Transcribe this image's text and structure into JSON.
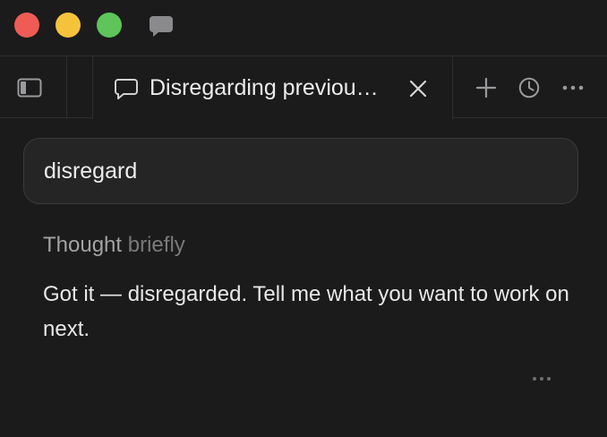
{
  "window": {
    "traffic_colors": {
      "close": "#ee5c55",
      "minimize": "#f5c33b",
      "zoom": "#5dc55a"
    },
    "app_icon": "chat-bubble-icon"
  },
  "tabbar": {
    "sidebar_icon": "sidebar-toggle-icon",
    "active_tab": {
      "icon": "chat-bubble-outline-icon",
      "title": "Disregarding previou…",
      "close_icon": "close-icon"
    },
    "actions": [
      "plus-icon",
      "history-icon",
      "more-horizontal-icon"
    ]
  },
  "conversation": {
    "user_message": "disregard",
    "thought_label": "Thought",
    "thought_duration": "briefly",
    "assistant_reply": "Got it — disregarded. Tell me what you want to work on next.",
    "message_actions_icon": "more-horizontal-icon"
  }
}
